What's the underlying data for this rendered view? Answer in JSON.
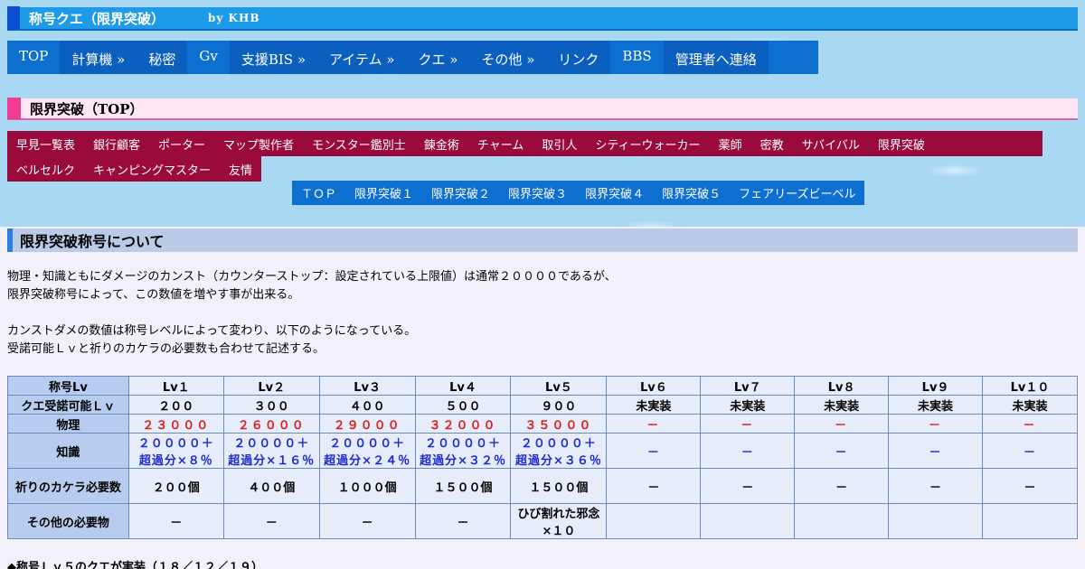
{
  "site": {
    "title": "称号クエ（限界突破）",
    "byline": "by KHB"
  },
  "main_nav": [
    "TOP",
    "計算機 »",
    "秘密",
    "Gv",
    "支援BIS »",
    "アイテム »",
    "クエ »",
    "その他 »",
    "リンク",
    "BBS",
    "管理者へ連絡"
  ],
  "section": {
    "title": "限界突破（TOP）"
  },
  "sub_nav_row1": [
    "早見一覧表",
    "銀行顧客",
    "ポーター",
    "マップ製作者",
    "モンスター鑑別士",
    "錬金術",
    "チャーム",
    "取引人",
    "シティーウォーカー",
    "薬師",
    "密教",
    "サバイバル",
    "限界突破"
  ],
  "sub_nav_row2": [
    "ベルセルク",
    "キャンピングマスター",
    "友情"
  ],
  "tab_nav": [
    "ＴＯＰ",
    "限界突破１",
    "限界突破２",
    "限界突破３",
    "限界突破４",
    "限界突破５",
    "フェアリーズビーベル"
  ],
  "heading": "限界突破称号について",
  "paragraphs": {
    "p1": "物理・知識ともにダメージのカンスト（カウンターストップ：設定されている上限値）は通常２００００であるが、",
    "p2": "限界突破称号によって、この数値を増やす事が出来る。",
    "p3": "カンストダメの数値は称号レベルによって変わり、以下のようになっている。",
    "p4": "受諾可能Ｌｖと祈りのカケラの必要数も合わせて記述する。"
  },
  "table": {
    "header_label": "称号Lv",
    "levels": [
      "Lv１",
      "Lv２",
      "Lv３",
      "Lv４",
      "Lv５",
      "Lv６",
      "Lv７",
      "Lv８",
      "Lv９",
      "Lv１０"
    ],
    "rows": {
      "accept_label": "クエ受諾可能Ｌｖ",
      "accept": [
        "２００",
        "３００",
        "４００",
        "５００",
        "９００",
        "未実装",
        "未実装",
        "未実装",
        "未実装",
        "未実装"
      ],
      "physical_label": "物理",
      "physical": [
        "２３０００",
        "２６０００",
        "２９０００",
        "３２０００",
        "３５０００",
        "－",
        "－",
        "－",
        "－",
        "－"
      ],
      "knowledge_label": "知識",
      "knowledge_top": [
        "２００００＋",
        "２００００＋",
        "２００００＋",
        "２００００＋",
        "２００００＋"
      ],
      "knowledge_bottom": [
        "超過分×８％",
        "超過分×１６％",
        "超過分×２４％",
        "超過分×３２％",
        "超過分×３６％"
      ],
      "knowledge_rest": [
        "－",
        "－",
        "－",
        "－",
        "－"
      ],
      "prayer_label": "祈りのカケラ必要数",
      "prayer": [
        "２００個",
        "４００個",
        "１０００個",
        "１５００個",
        "１５００個",
        "－",
        "－",
        "－",
        "－",
        "－"
      ],
      "other_label": "その他の必要物",
      "other": [
        "－",
        "－",
        "－",
        "－",
        "ひび割れた邪念×１０",
        "",
        "",
        "",
        "",
        ""
      ]
    }
  },
  "footer_note": "◆称号Ｌｖ５のクエが実装（１８／１２／１９）",
  "colors": {
    "red_value": "#e01818",
    "blue_value": "#1a2ad0",
    "nav_blue": "#0d6fd0",
    "sub_nav_red": "#9a0a3c"
  }
}
